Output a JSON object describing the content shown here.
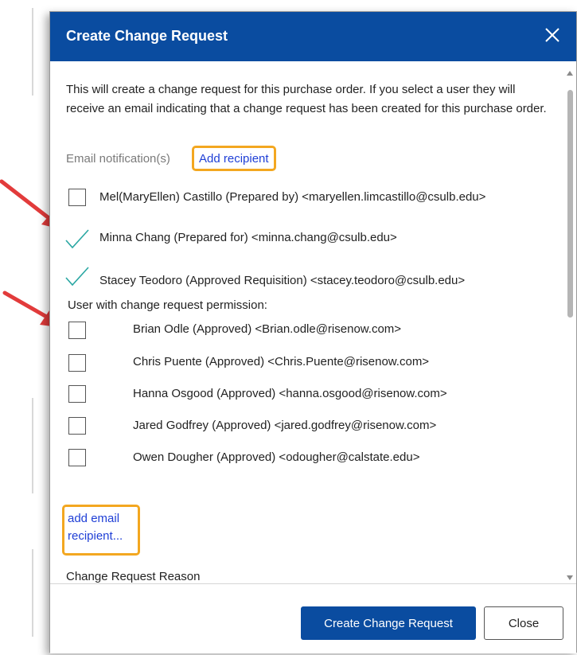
{
  "dialog": {
    "title": "Create Change Request",
    "intro": "This will create a change request for this purchase order. If you select a user they will receive an email indicating that a change request has been created for this purchase order.",
    "notifications_label": "Email notification(s)",
    "add_recipient_label": "Add recipient",
    "notification_recipients": [
      {
        "label": "Mel(MaryEllen) Castillo (Prepared by) <maryellen.limcastillo@csulb.edu>",
        "checked": false
      },
      {
        "label": "Minna Chang (Prepared for) <minna.chang@csulb.edu>",
        "checked": true
      },
      {
        "label": "Stacey Teodoro (Approved Requisition) <stacey.teodoro@csulb.edu>",
        "checked": true
      }
    ],
    "permission_label": "User with change request permission:",
    "permission_users": [
      {
        "label": "Brian Odle (Approved) <Brian.odle@risenow.com>",
        "checked": false
      },
      {
        "label": "Chris Puente (Approved) <Chris.Puente@risenow.com>",
        "checked": false
      },
      {
        "label": "Hanna Osgood (Approved) <hanna.osgood@risenow.com>",
        "checked": false
      },
      {
        "label": "Jared Godfrey (Approved) <jared.godfrey@risenow.com>",
        "checked": false
      },
      {
        "label": "Owen Dougher (Approved) <odougher@calstate.edu>",
        "checked": false
      }
    ],
    "add_email_line1": "add email",
    "add_email_line2": "recipient...",
    "reason_label": "Change Request Reason",
    "reason_value": "",
    "create_button": "Create Change Request",
    "close_button": "Close"
  },
  "colors": {
    "header": "#0a4ca0",
    "highlight": "#f3a720",
    "link": "#1f3fd6",
    "checkmark": "#2aa7a3",
    "arrow": "#e23b3b"
  },
  "icons": [
    "close-icon",
    "checkmark-icon",
    "red-arrow-icon"
  ]
}
